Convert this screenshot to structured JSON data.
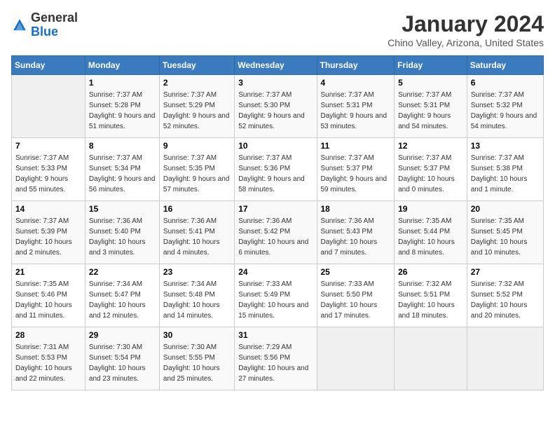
{
  "header": {
    "logo_general": "General",
    "logo_blue": "Blue",
    "title": "January 2024",
    "subtitle": "Chino Valley, Arizona, United States"
  },
  "days_of_week": [
    "Sunday",
    "Monday",
    "Tuesday",
    "Wednesday",
    "Thursday",
    "Friday",
    "Saturday"
  ],
  "weeks": [
    [
      {
        "day": "",
        "empty": true
      },
      {
        "day": "1",
        "sunrise": "Sunrise: 7:37 AM",
        "sunset": "Sunset: 5:28 PM",
        "daylight": "Daylight: 9 hours and 51 minutes."
      },
      {
        "day": "2",
        "sunrise": "Sunrise: 7:37 AM",
        "sunset": "Sunset: 5:29 PM",
        "daylight": "Daylight: 9 hours and 52 minutes."
      },
      {
        "day": "3",
        "sunrise": "Sunrise: 7:37 AM",
        "sunset": "Sunset: 5:30 PM",
        "daylight": "Daylight: 9 hours and 52 minutes."
      },
      {
        "day": "4",
        "sunrise": "Sunrise: 7:37 AM",
        "sunset": "Sunset: 5:31 PM",
        "daylight": "Daylight: 9 hours and 53 minutes."
      },
      {
        "day": "5",
        "sunrise": "Sunrise: 7:37 AM",
        "sunset": "Sunset: 5:31 PM",
        "daylight": "Daylight: 9 hours and 54 minutes."
      },
      {
        "day": "6",
        "sunrise": "Sunrise: 7:37 AM",
        "sunset": "Sunset: 5:32 PM",
        "daylight": "Daylight: 9 hours and 54 minutes."
      }
    ],
    [
      {
        "day": "7",
        "sunrise": "Sunrise: 7:37 AM",
        "sunset": "Sunset: 5:33 PM",
        "daylight": "Daylight: 9 hours and 55 minutes."
      },
      {
        "day": "8",
        "sunrise": "Sunrise: 7:37 AM",
        "sunset": "Sunset: 5:34 PM",
        "daylight": "Daylight: 9 hours and 56 minutes."
      },
      {
        "day": "9",
        "sunrise": "Sunrise: 7:37 AM",
        "sunset": "Sunset: 5:35 PM",
        "daylight": "Daylight: 9 hours and 57 minutes."
      },
      {
        "day": "10",
        "sunrise": "Sunrise: 7:37 AM",
        "sunset": "Sunset: 5:36 PM",
        "daylight": "Daylight: 9 hours and 58 minutes."
      },
      {
        "day": "11",
        "sunrise": "Sunrise: 7:37 AM",
        "sunset": "Sunset: 5:37 PM",
        "daylight": "Daylight: 9 hours and 59 minutes."
      },
      {
        "day": "12",
        "sunrise": "Sunrise: 7:37 AM",
        "sunset": "Sunset: 5:37 PM",
        "daylight": "Daylight: 10 hours and 0 minutes."
      },
      {
        "day": "13",
        "sunrise": "Sunrise: 7:37 AM",
        "sunset": "Sunset: 5:38 PM",
        "daylight": "Daylight: 10 hours and 1 minute."
      }
    ],
    [
      {
        "day": "14",
        "sunrise": "Sunrise: 7:37 AM",
        "sunset": "Sunset: 5:39 PM",
        "daylight": "Daylight: 10 hours and 2 minutes."
      },
      {
        "day": "15",
        "sunrise": "Sunrise: 7:36 AM",
        "sunset": "Sunset: 5:40 PM",
        "daylight": "Daylight: 10 hours and 3 minutes."
      },
      {
        "day": "16",
        "sunrise": "Sunrise: 7:36 AM",
        "sunset": "Sunset: 5:41 PM",
        "daylight": "Daylight: 10 hours and 4 minutes."
      },
      {
        "day": "17",
        "sunrise": "Sunrise: 7:36 AM",
        "sunset": "Sunset: 5:42 PM",
        "daylight": "Daylight: 10 hours and 6 minutes."
      },
      {
        "day": "18",
        "sunrise": "Sunrise: 7:36 AM",
        "sunset": "Sunset: 5:43 PM",
        "daylight": "Daylight: 10 hours and 7 minutes."
      },
      {
        "day": "19",
        "sunrise": "Sunrise: 7:35 AM",
        "sunset": "Sunset: 5:44 PM",
        "daylight": "Daylight: 10 hours and 8 minutes."
      },
      {
        "day": "20",
        "sunrise": "Sunrise: 7:35 AM",
        "sunset": "Sunset: 5:45 PM",
        "daylight": "Daylight: 10 hours and 10 minutes."
      }
    ],
    [
      {
        "day": "21",
        "sunrise": "Sunrise: 7:35 AM",
        "sunset": "Sunset: 5:46 PM",
        "daylight": "Daylight: 10 hours and 11 minutes."
      },
      {
        "day": "22",
        "sunrise": "Sunrise: 7:34 AM",
        "sunset": "Sunset: 5:47 PM",
        "daylight": "Daylight: 10 hours and 12 minutes."
      },
      {
        "day": "23",
        "sunrise": "Sunrise: 7:34 AM",
        "sunset": "Sunset: 5:48 PM",
        "daylight": "Daylight: 10 hours and 14 minutes."
      },
      {
        "day": "24",
        "sunrise": "Sunrise: 7:33 AM",
        "sunset": "Sunset: 5:49 PM",
        "daylight": "Daylight: 10 hours and 15 minutes."
      },
      {
        "day": "25",
        "sunrise": "Sunrise: 7:33 AM",
        "sunset": "Sunset: 5:50 PM",
        "daylight": "Daylight: 10 hours and 17 minutes."
      },
      {
        "day": "26",
        "sunrise": "Sunrise: 7:32 AM",
        "sunset": "Sunset: 5:51 PM",
        "daylight": "Daylight: 10 hours and 18 minutes."
      },
      {
        "day": "27",
        "sunrise": "Sunrise: 7:32 AM",
        "sunset": "Sunset: 5:52 PM",
        "daylight": "Daylight: 10 hours and 20 minutes."
      }
    ],
    [
      {
        "day": "28",
        "sunrise": "Sunrise: 7:31 AM",
        "sunset": "Sunset: 5:53 PM",
        "daylight": "Daylight: 10 hours and 22 minutes."
      },
      {
        "day": "29",
        "sunrise": "Sunrise: 7:30 AM",
        "sunset": "Sunset: 5:54 PM",
        "daylight": "Daylight: 10 hours and 23 minutes."
      },
      {
        "day": "30",
        "sunrise": "Sunrise: 7:30 AM",
        "sunset": "Sunset: 5:55 PM",
        "daylight": "Daylight: 10 hours and 25 minutes."
      },
      {
        "day": "31",
        "sunrise": "Sunrise: 7:29 AM",
        "sunset": "Sunset: 5:56 PM",
        "daylight": "Daylight: 10 hours and 27 minutes."
      },
      {
        "day": "",
        "empty": true
      },
      {
        "day": "",
        "empty": true
      },
      {
        "day": "",
        "empty": true
      }
    ]
  ]
}
